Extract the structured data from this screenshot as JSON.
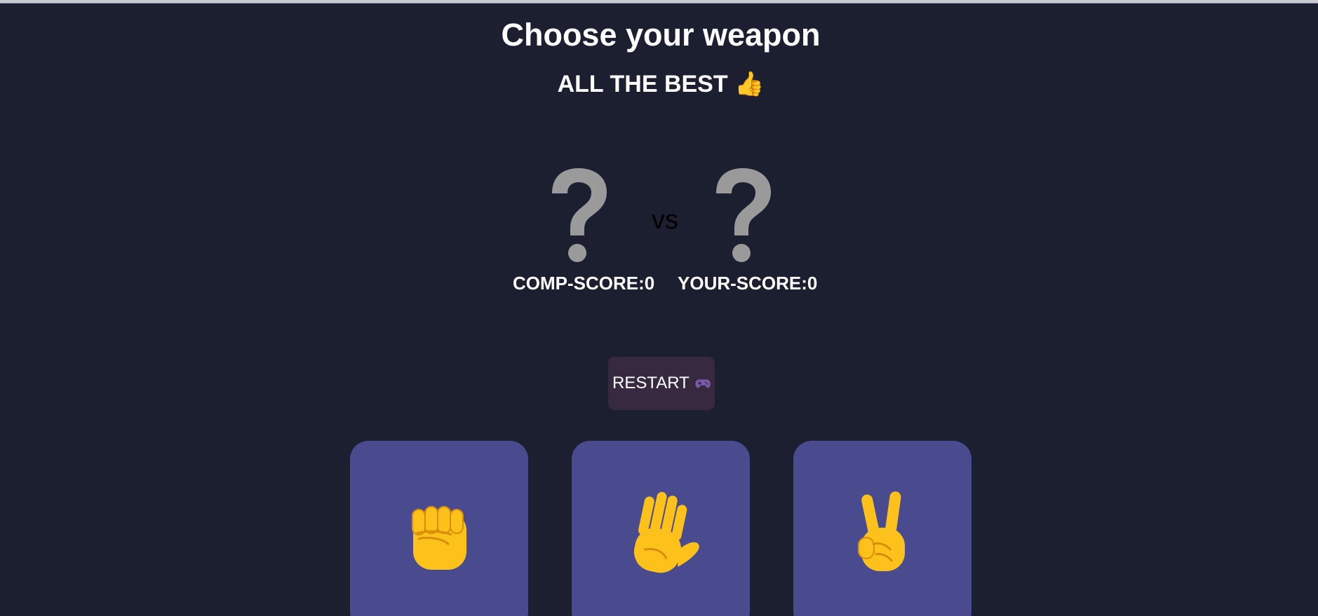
{
  "header": {
    "title": "Choose your weapon",
    "subtitle": "ALL THE BEST 👍"
  },
  "match": {
    "comp_choice_icon": "question-mark-icon",
    "user_choice_icon": "question-mark-icon",
    "vs_label": "vs",
    "comp_score_label": "COMP-SCORE:0",
    "user_score_label": "YOUR-SCORE:0"
  },
  "controls": {
    "restart_label": "RESTART",
    "restart_icon": "gamepad-icon"
  },
  "weapons": [
    {
      "name": "rock",
      "icon": "raised-fist-icon"
    },
    {
      "name": "paper",
      "icon": "raised-hand-icon"
    },
    {
      "name": "scissors",
      "icon": "victory-hand-icon"
    }
  ],
  "colors": {
    "background": "#1c1f30",
    "weapon_card": "#4a4a8e",
    "restart_button": "#372a40",
    "question_mark": "#9a9a9a",
    "emoji_yellow": "#fcc21b"
  }
}
